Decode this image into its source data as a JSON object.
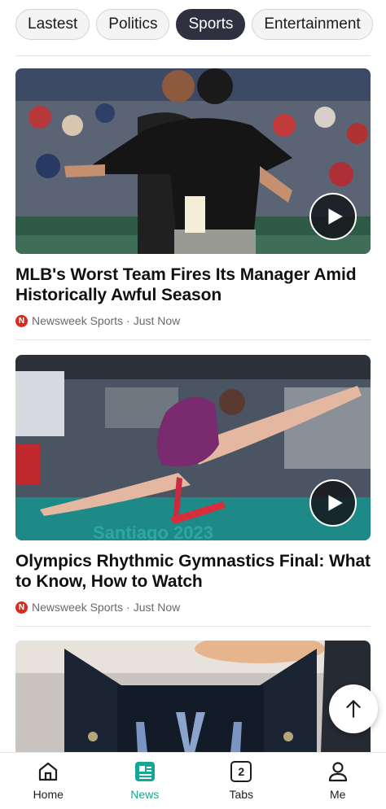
{
  "categories": [
    {
      "label": "Lastest",
      "active": false
    },
    {
      "label": "Politics",
      "active": false
    },
    {
      "label": "Sports",
      "active": true
    },
    {
      "label": "Entertainment",
      "active": false
    }
  ],
  "articles": [
    {
      "headline": "MLB's Worst Team Fires Its Manager Amid Historically Awful Season",
      "source": "Newsweek Sports",
      "separator": "·",
      "time": "Just Now",
      "has_video": true,
      "image_icon": "baseball-dispute-image"
    },
    {
      "headline": "Olympics Rhythmic Gymnastics Final: What to Know, How to Watch",
      "source": "Newsweek Sports",
      "separator": "·",
      "time": "Just Now",
      "has_video": true,
      "image_icon": "gymnast-image",
      "image_banner_text": "Santiago 2023"
    },
    {
      "headline": "",
      "image_icon": "medal-case-image"
    }
  ],
  "source_logo_letter": "N",
  "bottom_nav": [
    {
      "label": "Home",
      "icon": "home-icon",
      "active": false
    },
    {
      "label": "News",
      "icon": "news-icon",
      "active": true
    },
    {
      "label": "Tabs",
      "icon": "tabs-icon",
      "badge": "2",
      "active": false
    },
    {
      "label": "Me",
      "icon": "person-icon",
      "active": false
    }
  ],
  "colors": {
    "accent": "#16a596",
    "chip_active_bg": "#2f3140",
    "source_logo": "#d72b20"
  }
}
